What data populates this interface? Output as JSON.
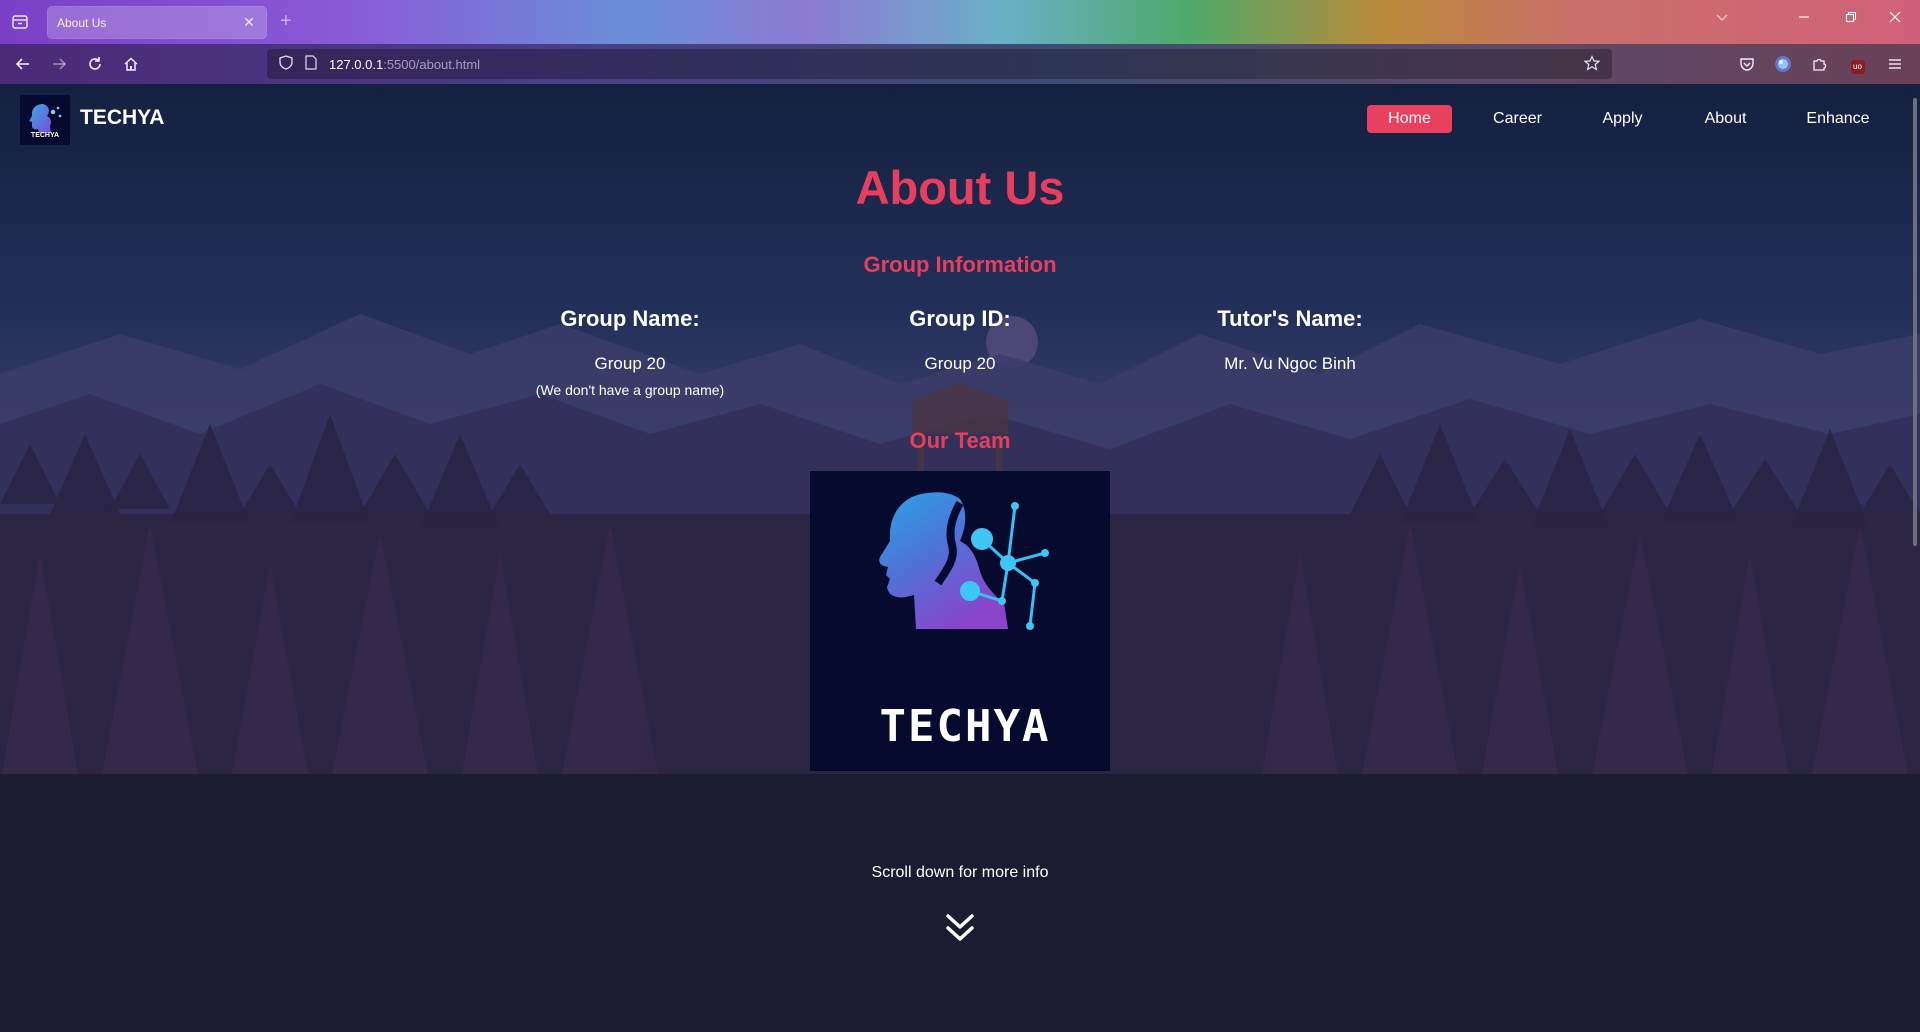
{
  "browser": {
    "tab_title": "About Us",
    "url_host": "127.0.0.1",
    "url_path": ":5500/about.html"
  },
  "site": {
    "brand": "TECHYA",
    "logo_text": "TECHYA",
    "nav": [
      "Home",
      "Career",
      "Apply",
      "About",
      "Enhance"
    ],
    "active_nav": "Home"
  },
  "page": {
    "title": "About Us",
    "group_info_heading": "Group Information",
    "columns": [
      {
        "label": "Group Name:",
        "value": "Group 20",
        "note": "(We don't have a group name)"
      },
      {
        "label": "Group ID:",
        "value": "Group 20",
        "note": ""
      },
      {
        "label": "Tutor's Name:",
        "value": "Mr. Vu Ngoc Binh",
        "note": ""
      }
    ],
    "team_heading": "Our Team",
    "team_logo_text": "TECHYA",
    "scroll_hint": "Scroll down for more info"
  },
  "colors": {
    "accent": "#e63f5e",
    "nav_active_bg": "#e8405e",
    "logo_bg": "#050a2e"
  }
}
